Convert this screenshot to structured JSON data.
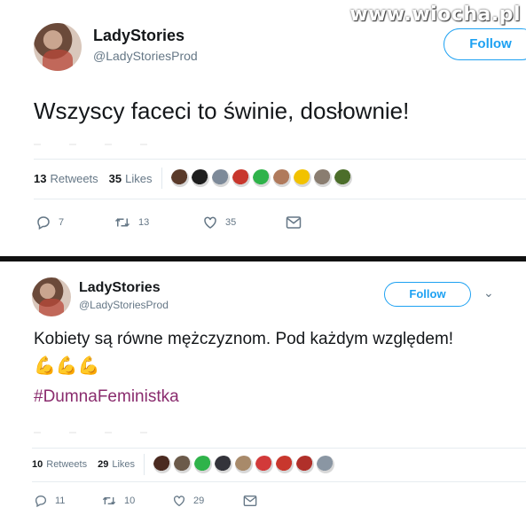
{
  "watermark": "www.wiocha.pl",
  "tweets": [
    {
      "name": "LadyStories",
      "handle": "@LadyStoriesProd",
      "follow_label": "Follow",
      "text": "Wszyscy faceci to świnie, dosłownie!",
      "retweets_count": "13",
      "retweets_label": "Retweets",
      "likes_count": "35",
      "likes_label": "Likes",
      "liker_colors": [
        "#5a3a2a",
        "#1e1e1e",
        "#7d8a99",
        "#c8372d",
        "#2fb34a",
        "#b07a5c",
        "#f2c200",
        "#8a7d70",
        "#4c6e2a"
      ],
      "reply_count": "7",
      "retweet_action_count": "13",
      "like_action_count": "35"
    },
    {
      "name": "LadyStories",
      "handle": "@LadyStoriesProd",
      "follow_label": "Follow",
      "text": "Kobiety są równe mężczyznom. Pod każdym względem!",
      "emoji": "💪💪💪",
      "hashtag": "#DumnaFeministka",
      "retweets_count": "10",
      "retweets_label": "Retweets",
      "likes_count": "29",
      "likes_label": "Likes",
      "liker_colors": [
        "#4a2a20",
        "#6b5a4a",
        "#2fb34a",
        "#33333a",
        "#a88a6a",
        "#d23a3a",
        "#c8372d",
        "#b0302a",
        "#8a96a3"
      ],
      "reply_count": "11",
      "retweet_action_count": "10",
      "like_action_count": "29"
    }
  ]
}
